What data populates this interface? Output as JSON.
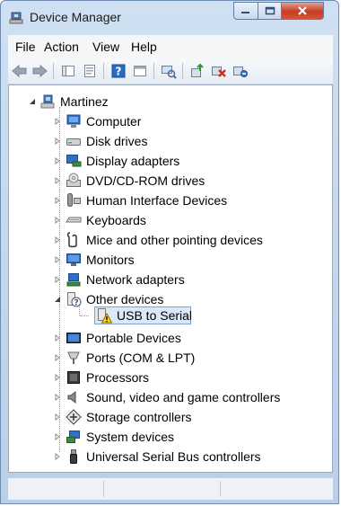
{
  "window": {
    "title": "Device Manager"
  },
  "menu": [
    "File",
    "Action",
    "View",
    "Help"
  ],
  "toolbar": [
    "back-icon",
    "forward-icon",
    "show-hide-tree-icon",
    "properties-icon",
    "help-icon",
    "view-icon",
    "scan-hardware-icon",
    "update-driver-icon",
    "uninstall-icon",
    "disable-icon"
  ],
  "tree": {
    "root": "Martinez",
    "items": [
      {
        "label": "Computer",
        "icon": "computer-icon",
        "expanded": false
      },
      {
        "label": "Disk drives",
        "icon": "disk-drive-icon",
        "expanded": false
      },
      {
        "label": "Display adapters",
        "icon": "display-adapter-icon",
        "expanded": false
      },
      {
        "label": "DVD/CD-ROM drives",
        "icon": "dvd-drive-icon",
        "expanded": false
      },
      {
        "label": "Human Interface Devices",
        "icon": "hid-icon",
        "expanded": false
      },
      {
        "label": "Keyboards",
        "icon": "keyboard-icon",
        "expanded": false
      },
      {
        "label": "Mice and other pointing devices",
        "icon": "mouse-icon",
        "expanded": false
      },
      {
        "label": "Monitors",
        "icon": "monitor-icon",
        "expanded": false
      },
      {
        "label": "Network adapters",
        "icon": "network-adapter-icon",
        "expanded": false
      },
      {
        "label": "Other devices",
        "icon": "unknown-device-icon",
        "expanded": true,
        "children": [
          {
            "label": "USB to Serial",
            "icon": "warning-device-icon",
            "selected": true
          }
        ]
      },
      {
        "label": "Portable Devices",
        "icon": "portable-device-icon",
        "expanded": false
      },
      {
        "label": "Ports (COM & LPT)",
        "icon": "port-icon",
        "expanded": false
      },
      {
        "label": "Processors",
        "icon": "processor-icon",
        "expanded": false
      },
      {
        "label": "Sound, video and game controllers",
        "icon": "sound-icon",
        "expanded": false
      },
      {
        "label": "Storage controllers",
        "icon": "storage-controller-icon",
        "expanded": false
      },
      {
        "label": "System devices",
        "icon": "system-device-icon",
        "expanded": false
      },
      {
        "label": "Universal Serial Bus controllers",
        "icon": "usb-icon",
        "expanded": false
      }
    ]
  },
  "colors": {
    "selection": "#dbe8f8",
    "close_button": "#c43b22",
    "accent": "#2a6cc4"
  }
}
